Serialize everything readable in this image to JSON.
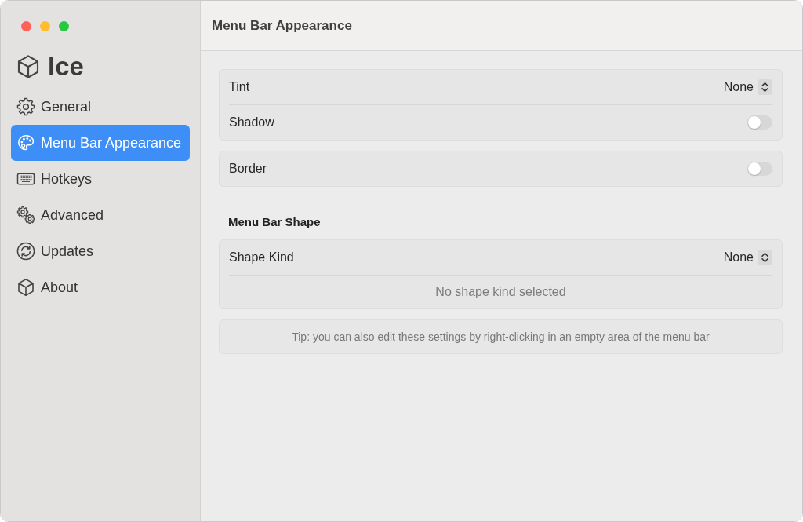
{
  "sidebar": {
    "app_name": "Ice",
    "items": [
      {
        "label": "General",
        "selected": false
      },
      {
        "label": "Menu Bar Appearance",
        "selected": true
      },
      {
        "label": "Hotkeys",
        "selected": false
      },
      {
        "label": "Advanced",
        "selected": false
      },
      {
        "label": "Updates",
        "selected": false
      },
      {
        "label": "About",
        "selected": false
      }
    ]
  },
  "header": {
    "title": "Menu Bar Appearance"
  },
  "content": [
    {
      "kind": "group",
      "rows": [
        {
          "kind": "picker",
          "label": "Tint",
          "value": "None"
        },
        {
          "kind": "toggle",
          "label": "Shadow",
          "on": false
        }
      ]
    },
    {
      "kind": "group",
      "rows": [
        {
          "kind": "toggle",
          "label": "Border",
          "on": false
        }
      ]
    },
    {
      "kind": "heading",
      "text": "Menu Bar Shape"
    },
    {
      "kind": "group",
      "rows": [
        {
          "kind": "picker",
          "label": "Shape Kind",
          "value": "None"
        },
        {
          "kind": "note",
          "text": "No shape kind selected"
        }
      ]
    },
    {
      "kind": "tip",
      "text": "Tip: you can also edit these settings by right-clicking in an empty area of the menu bar"
    }
  ]
}
